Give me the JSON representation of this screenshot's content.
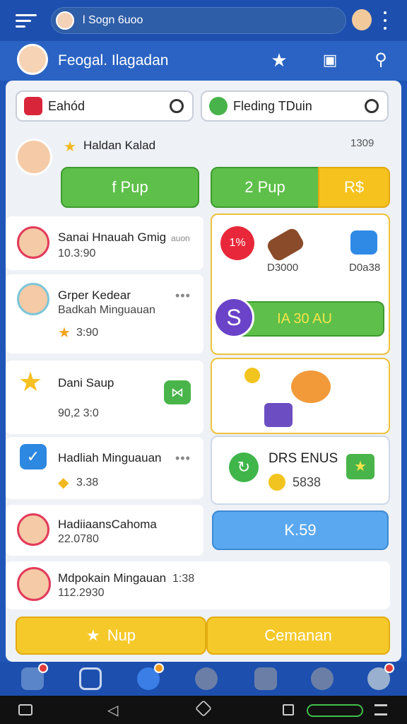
{
  "topbar": {
    "search_text": "l Sogn 6uoo"
  },
  "header": {
    "title": "Feogal. Ilagadan"
  },
  "chips": [
    {
      "label": "Eahód"
    },
    {
      "label": "Fleding TDuin"
    }
  ],
  "featured": {
    "name": "Haldan Kalad",
    "right_text": "1309"
  },
  "buttons": {
    "pup_left": "f Pup",
    "pup_right": "2 Pup",
    "badge_right": "R$"
  },
  "list": [
    {
      "title": "Sanai Hnauah Gmig",
      "extra": "auon",
      "value": "10.3:90"
    },
    {
      "title": "Grper Kedear",
      "subtitle": "Badkah Minguauan",
      "value": "3:90"
    },
    {
      "title": "Dani Saup",
      "value": "90,2 3:0"
    },
    {
      "title": "Hadliah Minguauan",
      "value": "3.38"
    },
    {
      "title": "HadiiaansCahoma",
      "value": "22.0780"
    },
    {
      "title": "Mdpokain Mingauan",
      "extra": "1:38",
      "value": "112.2930"
    }
  ],
  "reward_panel": {
    "item1": "D3000",
    "item2": "D0a38",
    "bar_text": "IA 30 AU"
  },
  "bonus_panel": {
    "title": "DRS ENUS",
    "amount": "5838"
  },
  "k_button": "K.59",
  "bottom_actions": {
    "left": "Nup",
    "right": "Cemanan"
  }
}
